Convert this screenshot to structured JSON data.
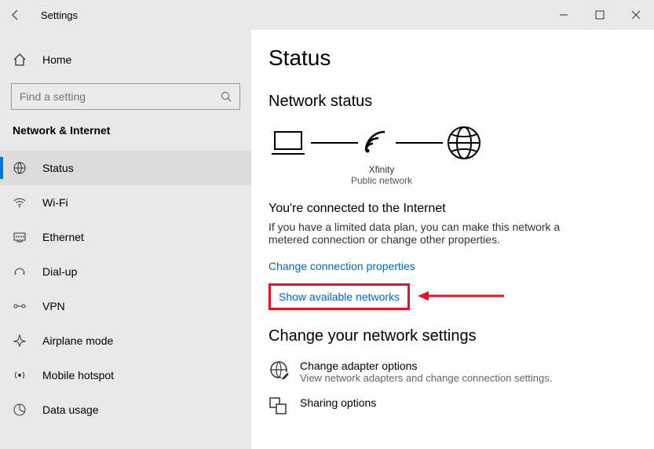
{
  "titlebar": {
    "title": "Settings"
  },
  "sidebar": {
    "home": "Home",
    "search_placeholder": "Find a setting",
    "section": "Network & Internet",
    "items": [
      {
        "label": "Status"
      },
      {
        "label": "Wi-Fi"
      },
      {
        "label": "Ethernet"
      },
      {
        "label": "Dial-up"
      },
      {
        "label": "VPN"
      },
      {
        "label": "Airplane mode"
      },
      {
        "label": "Mobile hotspot"
      },
      {
        "label": "Data usage"
      }
    ]
  },
  "main": {
    "heading": "Status",
    "subheading": "Network status",
    "diagram": {
      "ssid": "Xfinity",
      "type": "Public network"
    },
    "connected_title": "You're connected to the Internet",
    "connected_desc": "If you have a limited data plan, you can make this network a metered connection or change other properties.",
    "link_change": "Change connection properties",
    "link_show": "Show available networks",
    "settings_heading": "Change your network settings",
    "options": [
      {
        "title": "Change adapter options",
        "desc": "View network adapters and change connection settings."
      },
      {
        "title": "Sharing options",
        "desc": ""
      }
    ]
  }
}
